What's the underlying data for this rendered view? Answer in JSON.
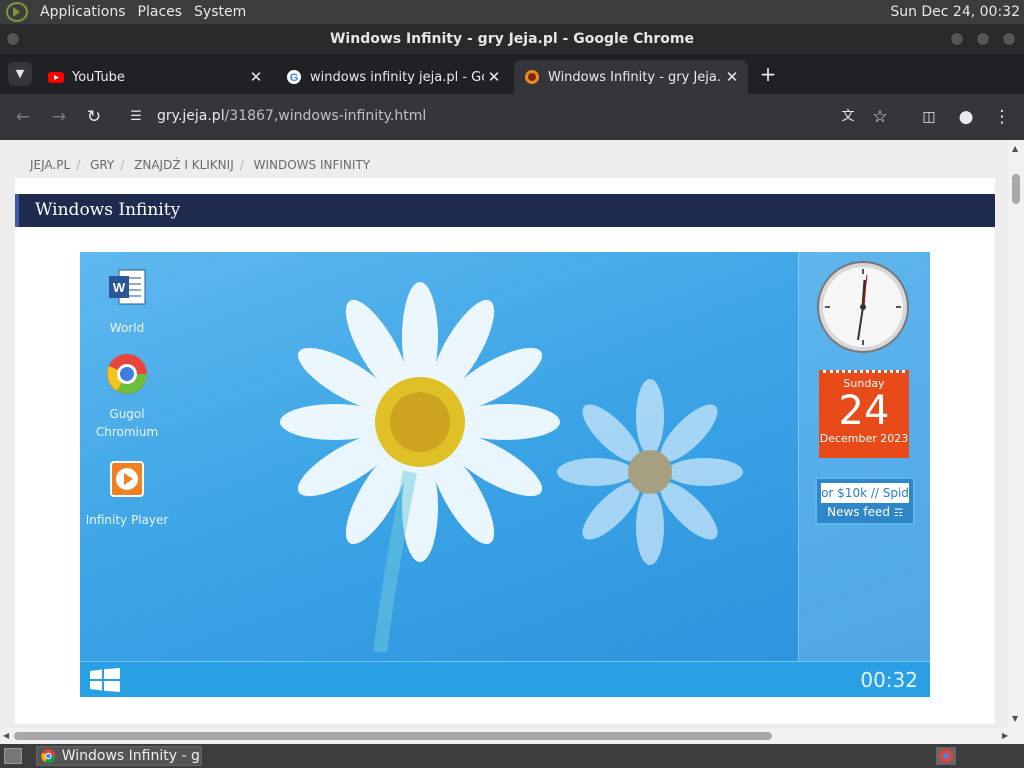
{
  "panel": {
    "menus": [
      "Applications",
      "Places",
      "System"
    ],
    "clock": "Sun Dec 24, 00:32"
  },
  "window": {
    "title": "Windows Infinity - gry Jeja.pl - Google Chrome"
  },
  "tabs": [
    {
      "label": "YouTube",
      "icon": "youtube-icon"
    },
    {
      "label": "windows infinity jeja.pl - Goo",
      "icon": "google-icon"
    },
    {
      "label": "Windows Infinity - gry Jeja.pl",
      "icon": "jeja-icon"
    }
  ],
  "toolbar": {
    "url_host": "gry.jeja.pl",
    "url_path": "/31867,windows-infinity.html"
  },
  "breadcrumb": [
    "JEJA.PL",
    "GRY",
    "ZNAJDŹ I KLIKNIJ",
    "WINDOWS INFINITY"
  ],
  "page": {
    "heading": "Windows Infinity"
  },
  "game": {
    "icons": [
      {
        "label": "World",
        "icon": "word-doc-icon"
      },
      {
        "label": "Gugol Chromium",
        "icon": "chromium-icon"
      },
      {
        "label": "Infinity Player",
        "icon": "media-player-icon"
      }
    ],
    "calendar": {
      "day_name": "Sunday",
      "day": "24",
      "month_year": "December 2023"
    },
    "news": {
      "ticker": "or $10k // Spid",
      "label": "News feed"
    },
    "clock": "00:32"
  },
  "taskbar": {
    "item": "Windows Infinity - g..."
  },
  "colors": {
    "header": "#1e2a4e",
    "game_bg": "#3ba4e6",
    "calendar": "#e84a1a"
  }
}
